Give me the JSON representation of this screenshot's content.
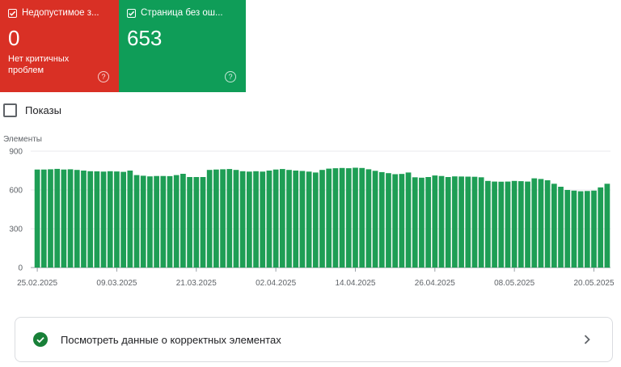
{
  "cards": {
    "invalid": {
      "title": "Недопустимое з...",
      "value": "0",
      "subtitle": "Нет критичных проблем",
      "color": "#d93025",
      "help_icon": "help-circle-icon"
    },
    "valid": {
      "title": "Страница без ош...",
      "value": "653",
      "color": "#0f9d58",
      "help_icon": "help-circle-icon"
    }
  },
  "impressions": {
    "label": "Показы",
    "checked": false
  },
  "link_row": {
    "label": "Посмотреть данные о корректных элементах",
    "status_icon": "check-circle-icon",
    "chevron_icon": "chevron-right-icon"
  },
  "chart_data": {
    "type": "bar",
    "ylabel": "Элементы",
    "ylim": [
      0,
      900
    ],
    "yticks": [
      0,
      300,
      600,
      900
    ],
    "grid": true,
    "color": "#1e9e55",
    "xtick_labels": [
      "25.02.2025",
      "09.03.2025",
      "21.03.2025",
      "02.04.2025",
      "14.04.2025",
      "26.04.2025",
      "08.05.2025",
      "20.05.2025"
    ],
    "xtick_every": 12,
    "values": [
      758,
      758,
      760,
      763,
      758,
      760,
      755,
      750,
      745,
      744,
      742,
      745,
      743,
      740,
      750,
      715,
      710,
      705,
      708,
      708,
      707,
      715,
      725,
      700,
      700,
      700,
      755,
      758,
      760,
      762,
      755,
      745,
      742,
      745,
      742,
      750,
      758,
      762,
      755,
      750,
      747,
      742,
      735,
      755,
      765,
      768,
      770,
      768,
      772,
      770,
      760,
      748,
      738,
      730,
      722,
      724,
      735,
      698,
      695,
      700,
      712,
      708,
      700,
      705,
      704,
      703,
      702,
      698,
      670,
      665,
      664,
      665,
      670,
      668,
      665,
      690,
      685,
      675,
      648,
      625,
      600,
      595,
      590,
      592,
      595,
      620,
      648
    ]
  }
}
